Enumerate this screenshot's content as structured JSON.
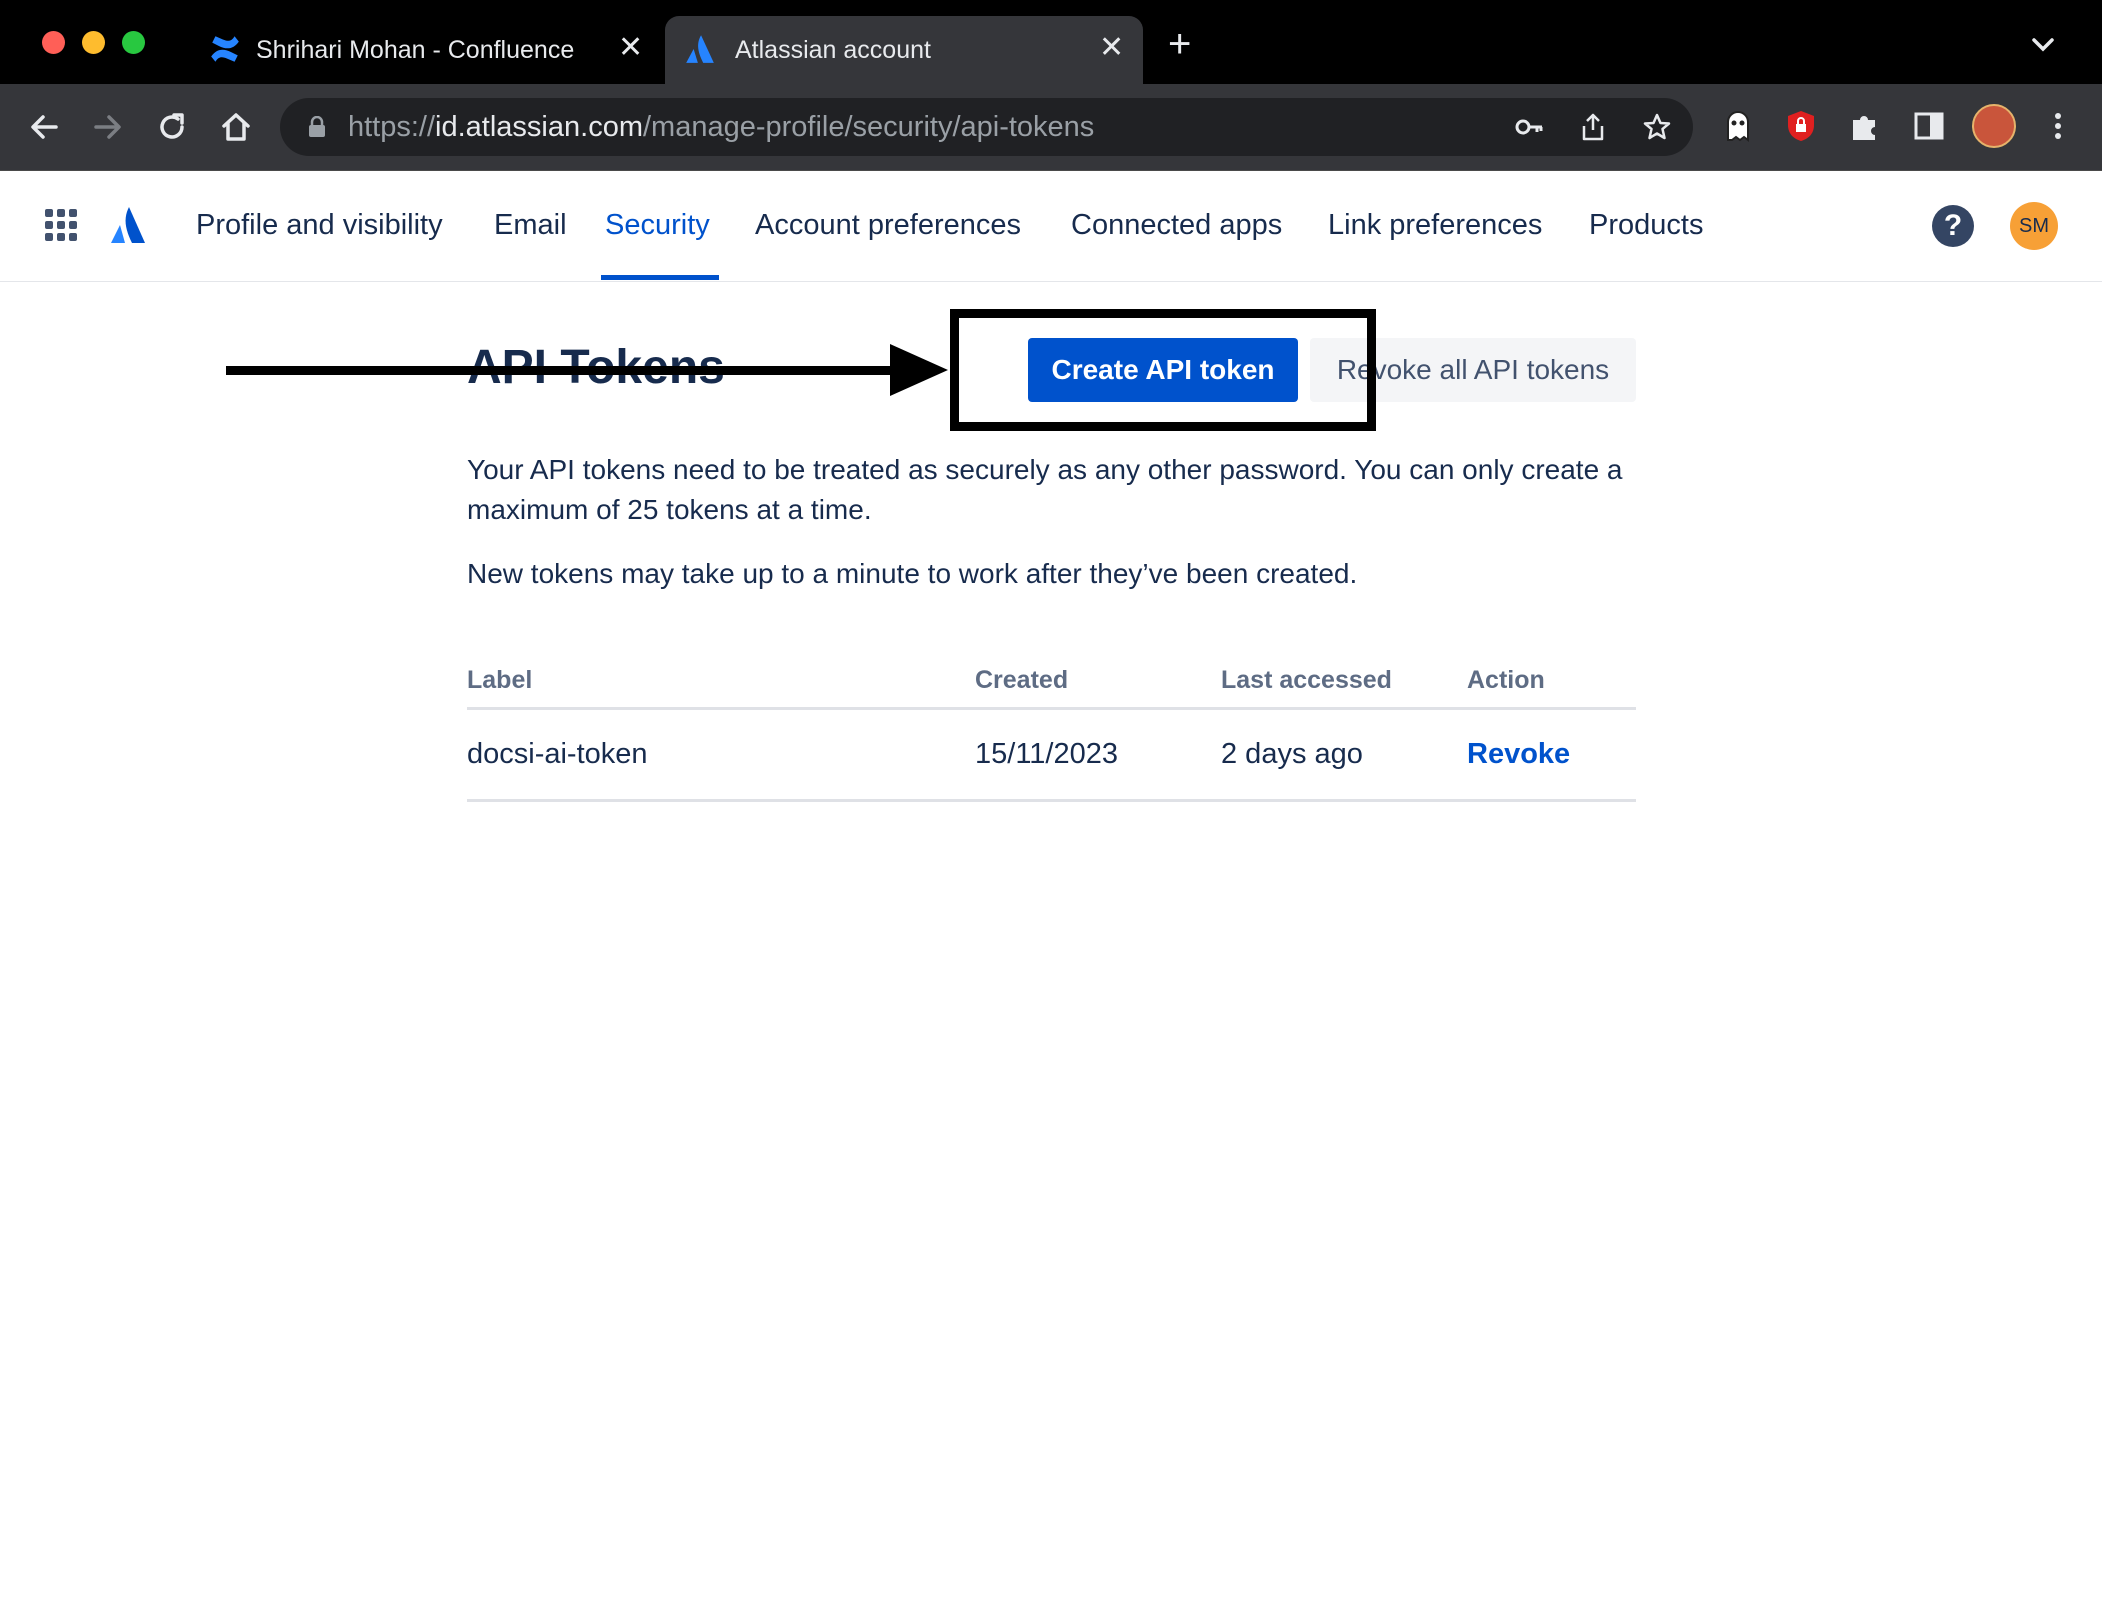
{
  "browser": {
    "tabs": [
      {
        "title": "Shrihari Mohan - Confluence",
        "icon": "confluence-icon"
      },
      {
        "title": "Atlassian account",
        "icon": "atlassian-icon",
        "active": true
      }
    ],
    "url": {
      "scheme": "https://",
      "host": "id.atlassian.com",
      "path": "/manage-profile/security/api-tokens"
    }
  },
  "header": {
    "nav": [
      {
        "label": "Profile and visibility"
      },
      {
        "label": "Email"
      },
      {
        "label": "Security",
        "active": true
      },
      {
        "label": "Account preferences"
      },
      {
        "label": "Connected apps"
      },
      {
        "label": "Link preferences"
      },
      {
        "label": "Products"
      }
    ],
    "help_icon": "?",
    "avatar_initials": "SM"
  },
  "main": {
    "title": "API Tokens",
    "create_button": "Create API token",
    "revoke_all_button": "Revoke all API tokens",
    "paragraph_1": "Your API tokens need to be treated as securely as any other password. You can only create a maximum of 25 tokens at a time.",
    "paragraph_2": "New tokens may take up to a minute to work after they’ve been created.",
    "table": {
      "columns": [
        "Label",
        "Created",
        "Last accessed",
        "Action"
      ],
      "rows": [
        {
          "label": "docsi-ai-token",
          "created": "15/11/2023",
          "last_accessed": "2 days ago",
          "action": "Revoke"
        }
      ]
    }
  },
  "colors": {
    "brand_blue": "#0052cc",
    "text_dark": "#172b4d",
    "avatar_bg": "#f7a036",
    "chrome_dark": "#35363a"
  }
}
